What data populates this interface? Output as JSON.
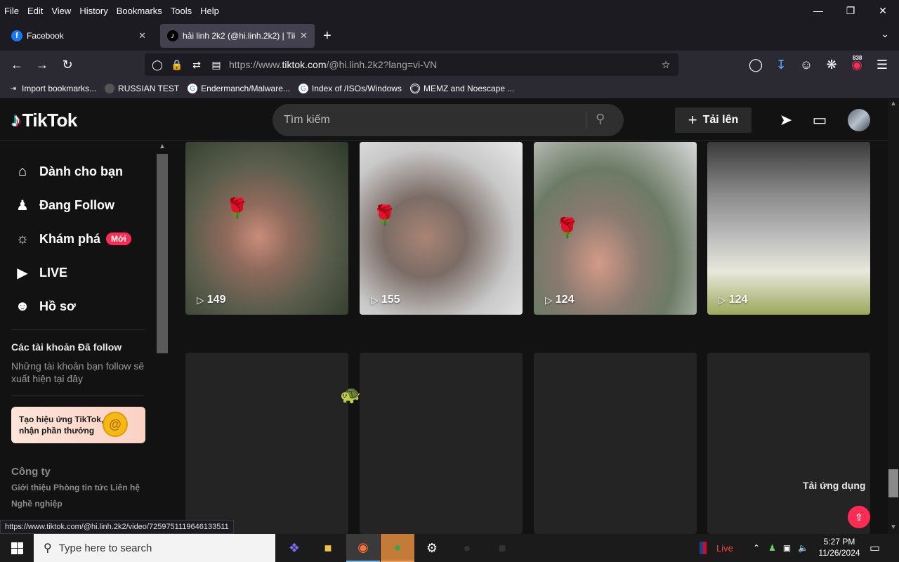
{
  "browser": {
    "menu": [
      "File",
      "Edit",
      "View",
      "History",
      "Bookmarks",
      "Tools",
      "Help"
    ],
    "tabs": [
      {
        "title": "Facebook"
      },
      {
        "title": "hải linh 2k2 (@hi.linh.2k2) | Tik"
      }
    ],
    "url_prefix": "https://www.",
    "url_host": "tiktok.com",
    "url_rest": "/@hi.linh.2k2?lang=vi-VN",
    "extension_badge": "838",
    "bookmarks": [
      "Import bookmarks...",
      "RUSSIAN TEST",
      "Endermanch/Malware...",
      "Index of /ISOs/Windows",
      "MEMZ and Noescape ..."
    ],
    "status_url": "https://www.tiktok.com/@hi.linh.2k2/video/7259751119646133511"
  },
  "tiktok": {
    "logo": "TikTok",
    "search_placeholder": "Tìm kiếm",
    "upload_label": "Tải lên",
    "sidebar": {
      "items": [
        {
          "label": "Dành cho bạn",
          "icon": "home-icon"
        },
        {
          "label": "Đang Follow",
          "icon": "people-icon"
        },
        {
          "label": "Khám phá",
          "icon": "compass-icon",
          "badge": "Mới"
        },
        {
          "label": "LIVE",
          "icon": "live-icon"
        },
        {
          "label": "Hồ sơ",
          "icon": "profile-icon"
        }
      ],
      "following_heading": "Các tài khoản Đã follow",
      "following_text": "Những tài khoản bạn follow sẽ xuất hiện tại đây",
      "effect_card": "Tạo hiệu ứng TikTok, nhận phần thưởng",
      "company_heading": "Công ty",
      "links": [
        "Giới thiệu",
        "Phòng tin tức",
        "Liên hệ",
        "Nghề nghiệp"
      ]
    },
    "videos": [
      {
        "views": "149"
      },
      {
        "views": "155"
      },
      {
        "views": "124"
      },
      {
        "views": "124"
      }
    ],
    "get_app": "Tải ứng dụng"
  },
  "taskbar": {
    "search_placeholder": "Type here to search",
    "live_label": "Live",
    "time": "5:27 PM",
    "date": "11/26/2024"
  },
  "colors": {
    "accent": "#fe2c55",
    "background": "#121212"
  }
}
